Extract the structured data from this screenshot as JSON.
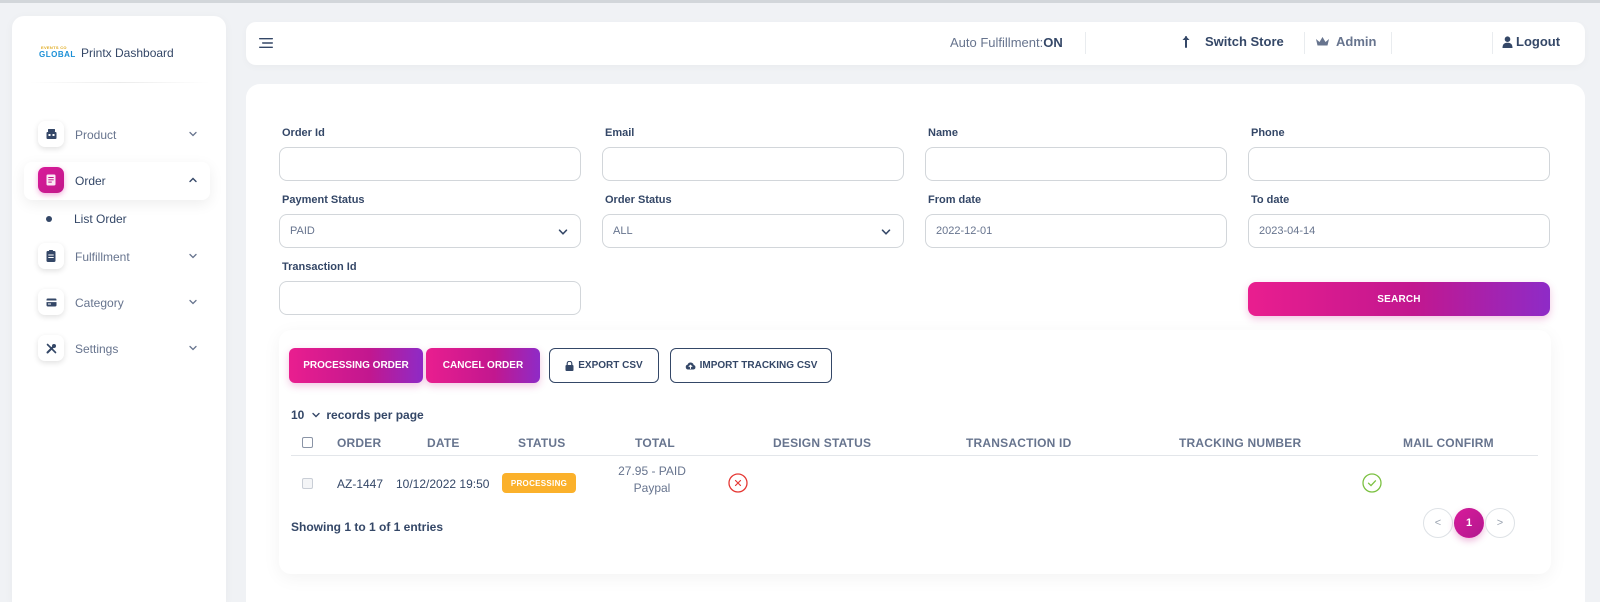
{
  "brand": {
    "logo_top": "EVENTS CO",
    "logo_main": "GLOBAL",
    "name": "Printx Dashboard"
  },
  "sidebar": {
    "items": [
      {
        "label": "Product",
        "icon": "shop-icon",
        "expanded": false
      },
      {
        "label": "Order",
        "icon": "order-doc-icon",
        "expanded": true,
        "active": true
      },
      {
        "label": "Fulfillment",
        "icon": "clipboard-icon",
        "expanded": false
      },
      {
        "label": "Category",
        "icon": "credit-card-icon",
        "expanded": false
      },
      {
        "label": "Settings",
        "icon": "settings-tools-icon",
        "expanded": false
      }
    ],
    "subitems": [
      {
        "label": "List Order",
        "active": true
      }
    ]
  },
  "topbar": {
    "auto_fulfillment_label": "Auto Fulfillment:",
    "auto_fulfillment_value": "ON",
    "switch_store": "Switch Store",
    "admin": "Admin",
    "logout": "Logout"
  },
  "filters": {
    "order_id": {
      "label": "Order Id",
      "value": ""
    },
    "email": {
      "label": "Email",
      "value": ""
    },
    "name": {
      "label": "Name",
      "value": ""
    },
    "phone": {
      "label": "Phone",
      "value": ""
    },
    "payment_status": {
      "label": "Payment Status",
      "value": "PAID"
    },
    "order_status": {
      "label": "Order Status",
      "value": "ALL"
    },
    "from_date": {
      "label": "From date",
      "value": "2022-12-01"
    },
    "to_date": {
      "label": "To date",
      "value": "2023-04-14"
    },
    "transaction_id": {
      "label": "Transaction Id",
      "value": ""
    },
    "search_button": "SEARCH"
  },
  "actions": {
    "processing_order": "PROCESSING ORDER",
    "cancel_order": "CANCEL ORDER",
    "export_csv": "EXPORT CSV",
    "import_tracking_csv": "IMPORT TRACKING CSV"
  },
  "table": {
    "per_page_value": "10",
    "per_page_label": "records per page",
    "columns": [
      "ORDER",
      "DATE",
      "STATUS",
      "TOTAL",
      "DESIGN STATUS",
      "TRANSACTION ID",
      "TRACKING NUMBER",
      "MAIL CONFIRM"
    ],
    "rows": [
      {
        "order": "AZ-1447",
        "date": "10/12/2022 19:50",
        "status": "PROCESSING",
        "total_line1": "27.95 - PAID",
        "total_line2": "Paypal",
        "design_status_icon": "x-circle-icon",
        "transaction_id": "",
        "tracking_number": "",
        "mail_confirm_icon": "check-circle-icon"
      }
    ],
    "showing": "Showing 1 to 1 of 1 entries"
  },
  "pagination": {
    "prev": "<",
    "current": "1",
    "next": ">"
  },
  "colors": {
    "accent": "#d81b9a",
    "accent_end": "#8e2bc7",
    "badge_processing": "#fbb12b",
    "error": "#e53935",
    "success": "#7cc142"
  }
}
